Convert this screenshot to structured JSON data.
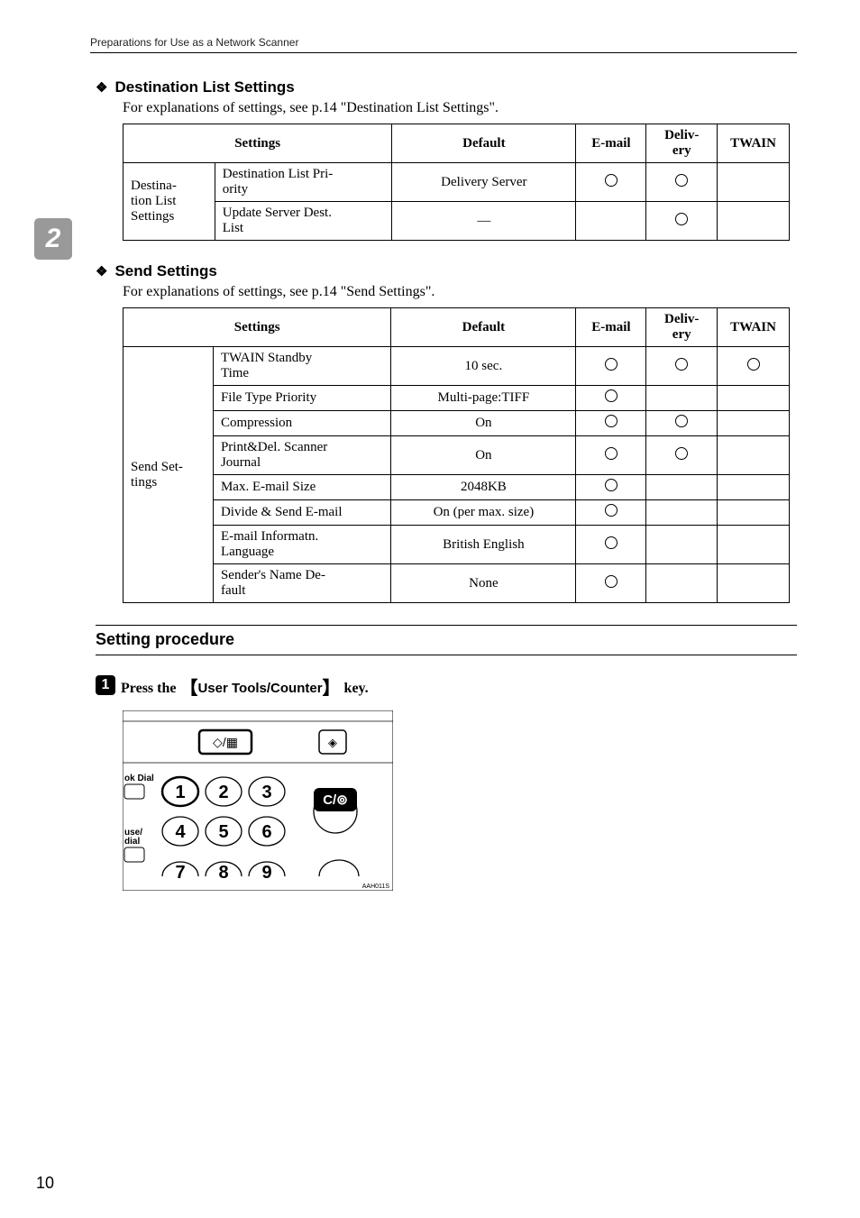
{
  "header": "Preparations for Use as a Network Scanner",
  "side_tab": "2",
  "dest": {
    "title": "Destination List Settings",
    "desc": "For explanations of settings, see p.14 \"Destination List Settings\".",
    "cols": [
      "Settings",
      "Default",
      "E-mail",
      "Delivery",
      "TWAIN"
    ],
    "rowgroup": "Destination List Settings",
    "rows": [
      {
        "name": "Destination List Priority",
        "default": "Delivery Server",
        "email": true,
        "deliv": true,
        "twain": false
      },
      {
        "name": "Update Server Dest. List",
        "default": "—",
        "email": false,
        "deliv": true,
        "twain": false
      }
    ]
  },
  "send": {
    "title": "Send Settings",
    "desc": "For explanations of settings, see p.14 \"Send Settings\".",
    "cols": [
      "Settings",
      "Default",
      "E-mail",
      "Delivery",
      "TWAIN"
    ],
    "rowgroup": "Send Settings",
    "rows": [
      {
        "name": "TWAIN Standby Time",
        "default": "10 sec.",
        "email": true,
        "deliv": true,
        "twain": true
      },
      {
        "name": "File Type Priority",
        "default": "Multi-page:TIFF",
        "email": true,
        "deliv": false,
        "twain": false
      },
      {
        "name": "Compression",
        "default": "On",
        "email": true,
        "deliv": true,
        "twain": false
      },
      {
        "name": "Print&Del. Scanner Journal",
        "default": "On",
        "email": true,
        "deliv": true,
        "twain": false
      },
      {
        "name": "Max. E-mail Size",
        "default": "2048KB",
        "email": true,
        "deliv": false,
        "twain": false
      },
      {
        "name": "Divide & Send E-mail",
        "default": "On (per max. size)",
        "email": true,
        "deliv": false,
        "twain": false
      },
      {
        "name": "E-mail Informatn. Language",
        "default": "British English",
        "email": true,
        "deliv": false,
        "twain": false
      },
      {
        "name": "Sender's Name Default",
        "default": "None",
        "email": true,
        "deliv": false,
        "twain": false
      }
    ]
  },
  "procedure": {
    "heading": "Setting procedure",
    "step1_prefix": "Press the ",
    "step1_key": "User Tools/Counter",
    "step1_suffix": " key."
  },
  "keypad": {
    "left_labels": [
      "ok Dial",
      "use/\ndial"
    ],
    "keys": [
      "1",
      "2",
      "3",
      "4",
      "5",
      "6",
      "7",
      "8",
      "9"
    ],
    "clear": "C/",
    "code": "AAH011S"
  },
  "page": "10",
  "chart_data": [
    {
      "type": "table",
      "title": "Destination List Settings",
      "columns": [
        "Setting",
        "Default",
        "E-mail",
        "Delivery",
        "TWAIN"
      ],
      "rows": [
        [
          "Destination List Priority",
          "Delivery Server",
          "yes",
          "yes",
          ""
        ],
        [
          "Update Server Dest. List",
          "—",
          "",
          "yes",
          ""
        ]
      ]
    },
    {
      "type": "table",
      "title": "Send Settings",
      "columns": [
        "Setting",
        "Default",
        "E-mail",
        "Delivery",
        "TWAIN"
      ],
      "rows": [
        [
          "TWAIN Standby Time",
          "10 sec.",
          "yes",
          "yes",
          "yes"
        ],
        [
          "File Type Priority",
          "Multi-page:TIFF",
          "yes",
          "",
          ""
        ],
        [
          "Compression",
          "On",
          "yes",
          "yes",
          ""
        ],
        [
          "Print&Del. Scanner Journal",
          "On",
          "yes",
          "yes",
          ""
        ],
        [
          "Max. E-mail Size",
          "2048KB",
          "yes",
          "",
          ""
        ],
        [
          "Divide & Send E-mail",
          "On (per max. size)",
          "yes",
          "",
          ""
        ],
        [
          "E-mail Informatn. Language",
          "British English",
          "yes",
          "",
          ""
        ],
        [
          "Sender's Name Default",
          "None",
          "yes",
          "",
          ""
        ]
      ]
    }
  ]
}
